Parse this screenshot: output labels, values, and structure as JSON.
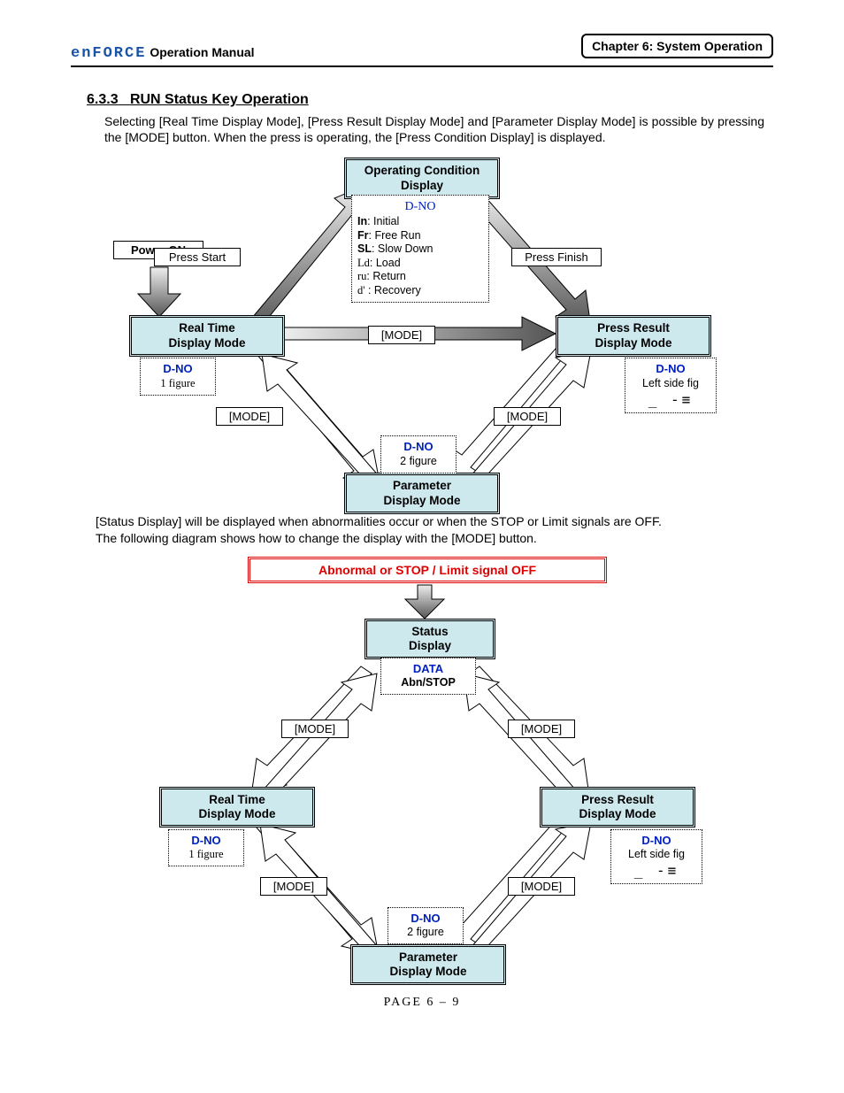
{
  "header": {
    "brand": "enFORCE",
    "subtitle": "Operation Manual",
    "chapter": "Chapter 6: System Operation"
  },
  "section": {
    "number": "6.3.3",
    "title": "RUN Status Key Operation",
    "para1": "Selecting [Real Time Display Mode], [Press Result Display Mode] and [Parameter Display Mode] is possible by pressing the [MODE] button. When the press is operating, the [Press Condition Display] is displayed.",
    "para2a": "[Status Display] will be displayed when abnormalities occur or when the STOP or Limit signals are OFF.",
    "para2b": "The following diagram shows how to change the display with the [MODE] button."
  },
  "d1": {
    "power_on": "Power ON",
    "op_cond_1": "Operating Condition",
    "op_cond_2": "Display",
    "dno_head": "D-NO",
    "legend_in": "In",
    "legend_in_t": ": Initial",
    "legend_fr": "Fr",
    "legend_fr_t": ": Free Run",
    "legend_sl": "SL",
    "legend_sl_t": ": Slow Down",
    "legend_ld": "Ld",
    "legend_ld_t": ": Load",
    "legend_ru": "ru",
    "legend_ru_t": ": Return",
    "legend_d": "d'",
    "legend_d_t": " : Recovery",
    "press_start": "Press Start",
    "press_finish": "Press Finish",
    "mode": "[MODE]",
    "real_1": "Real Time",
    "real_2": "Display Mode",
    "press_res_1": "Press Result",
    "press_res_2": "Display Mode",
    "dno": "D-NO",
    "fig1": "1 figure",
    "fig2": "2 figure",
    "leftfig": "Left side fig",
    "param_1": "Parameter",
    "param_2": "Display Mode"
  },
  "d2": {
    "abnormal": "Abnormal or STOP / Limit signal OFF",
    "status_1": "Status",
    "status_2": "Display",
    "data": "DATA",
    "abn": "Abn/STOP",
    "mode": "[MODE]",
    "real_1": "Real Time",
    "real_2": "Display Mode",
    "press_res_1": "Press Result",
    "press_res_2": "Display Mode",
    "dno": "D-NO",
    "fig1": "1 figure",
    "fig2": "2 figure",
    "leftfig": "Left side fig",
    "param_1": "Parameter",
    "param_2": "Display Mode"
  },
  "footer": "PAGE  6 – 9"
}
